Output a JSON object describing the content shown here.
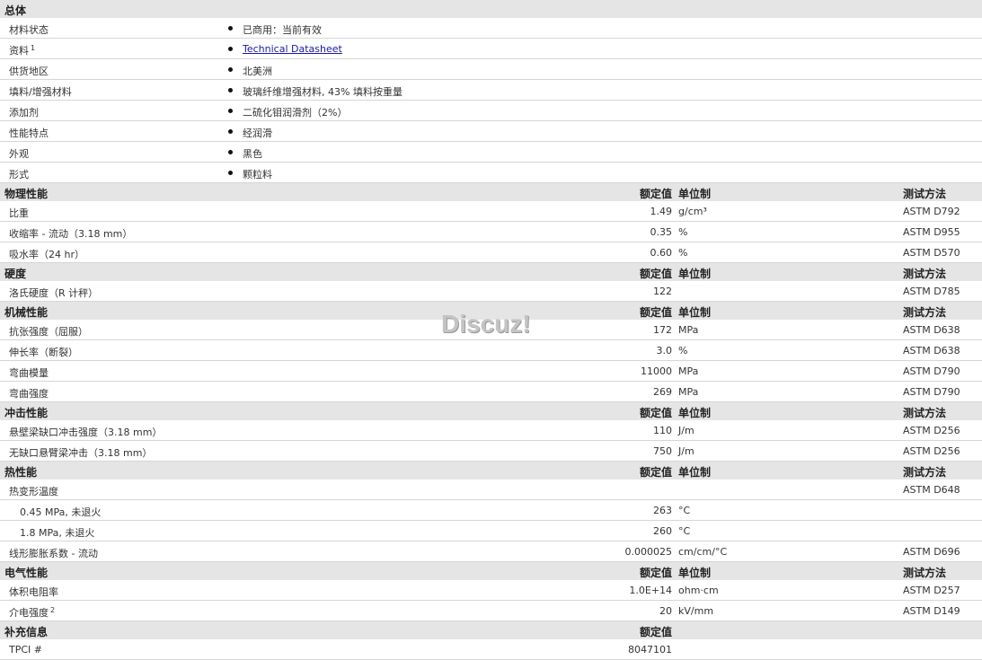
{
  "sections": [
    {
      "title": "总体",
      "kind": "general",
      "rows": [
        {
          "label": "材料状态",
          "value": "已商用：当前有效"
        },
        {
          "label": "资料",
          "sup": "1",
          "value": "Technical Datasheet",
          "link": true
        },
        {
          "label": "供货地区",
          "value": "北美洲"
        },
        {
          "label": "填料/增强材料",
          "value": "玻璃纤维增强材料, 43% 填料按重量"
        },
        {
          "label": "添加剂",
          "value": "二硫化钼润滑剂（2%）"
        },
        {
          "label": "性能特点",
          "value": "经润滑"
        },
        {
          "label": "外观",
          "value": "黑色"
        },
        {
          "label": "形式",
          "value": "颗粒料"
        }
      ]
    },
    {
      "title": "物理性能",
      "kind": "table",
      "col_value": "额定值",
      "col_unit": "单位制",
      "col_method": "测试方法",
      "rows": [
        {
          "label": "比重",
          "value": "1.49",
          "unit": "g/cm³",
          "method": "ASTM D792"
        },
        {
          "label": "收缩率 - 流动（3.18 mm）",
          "value": "0.35",
          "unit": "%",
          "method": "ASTM D955"
        },
        {
          "label": "吸水率（24 hr）",
          "value": "0.60",
          "unit": "%",
          "method": "ASTM D570"
        }
      ]
    },
    {
      "title": "硬度",
      "kind": "table",
      "col_value": "额定值",
      "col_unit": "单位制",
      "col_method": "测试方法",
      "rows": [
        {
          "label": "洛氏硬度（R 计秤）",
          "value": "122",
          "unit": "",
          "method": "ASTM D785"
        }
      ]
    },
    {
      "title": "机械性能",
      "kind": "table",
      "col_value": "额定值",
      "col_unit": "单位制",
      "col_method": "测试方法",
      "rows": [
        {
          "label": "抗张强度（屈服）",
          "value": "172",
          "unit": "MPa",
          "method": "ASTM D638"
        },
        {
          "label": "伸长率（断裂）",
          "value": "3.0",
          "unit": "%",
          "method": "ASTM D638"
        },
        {
          "label": "弯曲模量",
          "value": "11000",
          "unit": "MPa",
          "method": "ASTM D790"
        },
        {
          "label": "弯曲强度",
          "value": "269",
          "unit": "MPa",
          "method": "ASTM D790"
        }
      ]
    },
    {
      "title": "冲击性能",
      "kind": "table",
      "col_value": "额定值",
      "col_unit": "单位制",
      "col_method": "测试方法",
      "rows": [
        {
          "label": "悬壁梁缺口冲击强度（3.18 mm）",
          "value": "110",
          "unit": "J/m",
          "method": "ASTM D256"
        },
        {
          "label": "无缺口悬臂梁冲击（3.18 mm）",
          "value": "750",
          "unit": "J/m",
          "method": "ASTM D256"
        }
      ]
    },
    {
      "title": "热性能",
      "kind": "table",
      "col_value": "额定值",
      "col_unit": "单位制",
      "col_method": "测试方法",
      "rows": [
        {
          "label": "热变形温度",
          "value": "",
          "unit": "",
          "method": "ASTM D648"
        },
        {
          "label": "0.45 MPa, 未退火",
          "sub": true,
          "value": "263",
          "unit": "°C",
          "method": ""
        },
        {
          "label": "1.8 MPa, 未退火",
          "sub": true,
          "value": "260",
          "unit": "°C",
          "method": ""
        },
        {
          "label": "线形膨胀系数 - 流动",
          "value": "0.000025",
          "unit": "cm/cm/°C",
          "method": "ASTM D696"
        }
      ]
    },
    {
      "title": "电气性能",
      "kind": "table",
      "col_value": "额定值",
      "col_unit": "单位制",
      "col_method": "测试方法",
      "rows": [
        {
          "label": "体积电阻率",
          "value": "1.0E+14",
          "unit": "ohm·cm",
          "method": "ASTM D257"
        },
        {
          "label": "介电强度",
          "sup": "2",
          "value": "20",
          "unit": "kV/mm",
          "method": "ASTM D149"
        }
      ]
    },
    {
      "title": "补充信息",
      "kind": "table",
      "col_value": "额定值",
      "col_unit": "",
      "col_method": "",
      "rows": [
        {
          "label": "TPCI #",
          "value": "8047101",
          "unit": "",
          "method": ""
        }
      ]
    }
  ],
  "watermark": "Discuz!"
}
